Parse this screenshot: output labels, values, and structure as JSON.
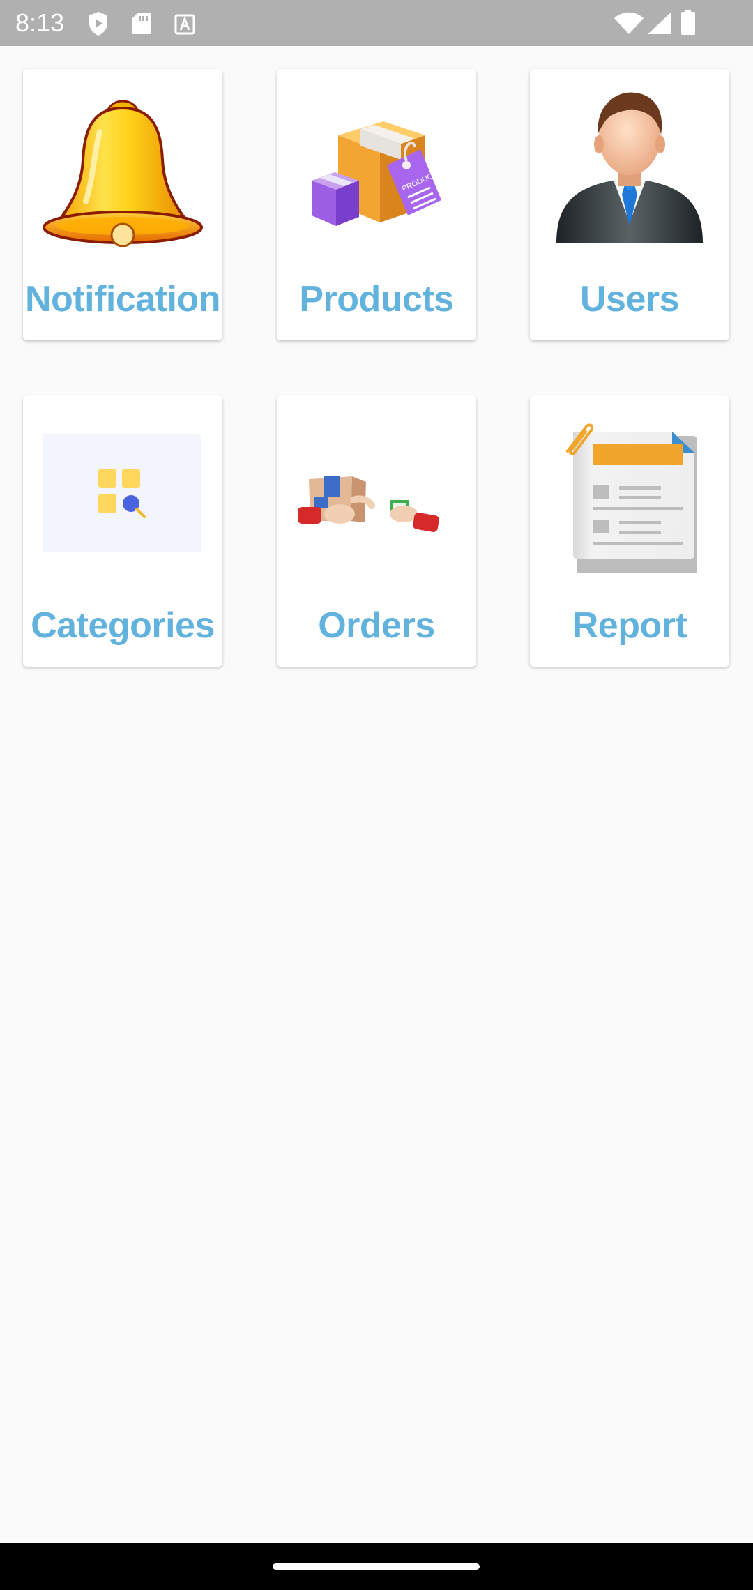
{
  "status_bar": {
    "time": "8:13",
    "left_icons": [
      "play-protect-icon",
      "sd-card-icon",
      "a-badge-icon"
    ],
    "right_icons": [
      "wifi-icon",
      "cell-signal-icon",
      "battery-icon"
    ]
  },
  "colors": {
    "label": "#62b2de",
    "background": "#fafafa",
    "status_bar": "#b0b0b0",
    "nav_bar": "#000000"
  },
  "tiles": [
    {
      "label": "Notification",
      "icon": "bell-icon"
    },
    {
      "label": "Products",
      "icon": "product-box-icon"
    },
    {
      "label": "Users",
      "icon": "user-avatar-icon"
    },
    {
      "label": "Categories",
      "icon": "categories-icon"
    },
    {
      "label": "Orders",
      "icon": "orders-delivery-icon"
    },
    {
      "label": "Report",
      "icon": "report-document-icon"
    }
  ],
  "art_text": {
    "product_tag": "PRODUCT"
  }
}
